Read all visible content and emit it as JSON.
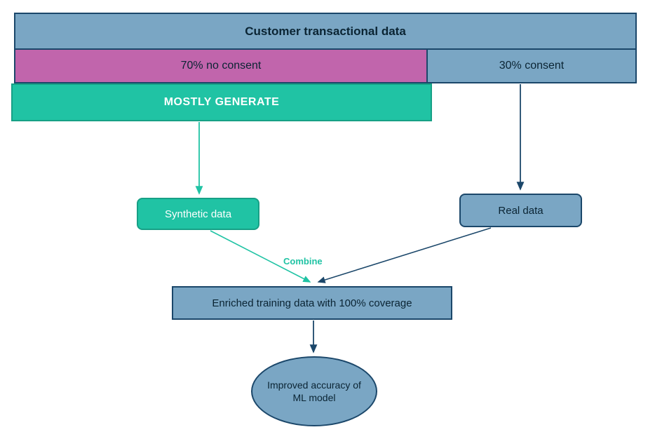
{
  "header": {
    "title": "Customer transactional data"
  },
  "split": {
    "no_consent": "70% no consent",
    "consent": "30% consent"
  },
  "generate": {
    "label": "MOSTLY GENERATE"
  },
  "nodes": {
    "synthetic": "Synthetic data",
    "real": "Real data",
    "combine": "Combine",
    "enriched": "Enriched training data with 100% coverage",
    "improved": "Improved accuracy of ML model"
  },
  "colors": {
    "blue_fill": "#7aa6c4",
    "blue_border": "#1b476a",
    "magenta": "#c165ac",
    "teal": "#20c3a4",
    "teal_dark": "#17a086"
  }
}
